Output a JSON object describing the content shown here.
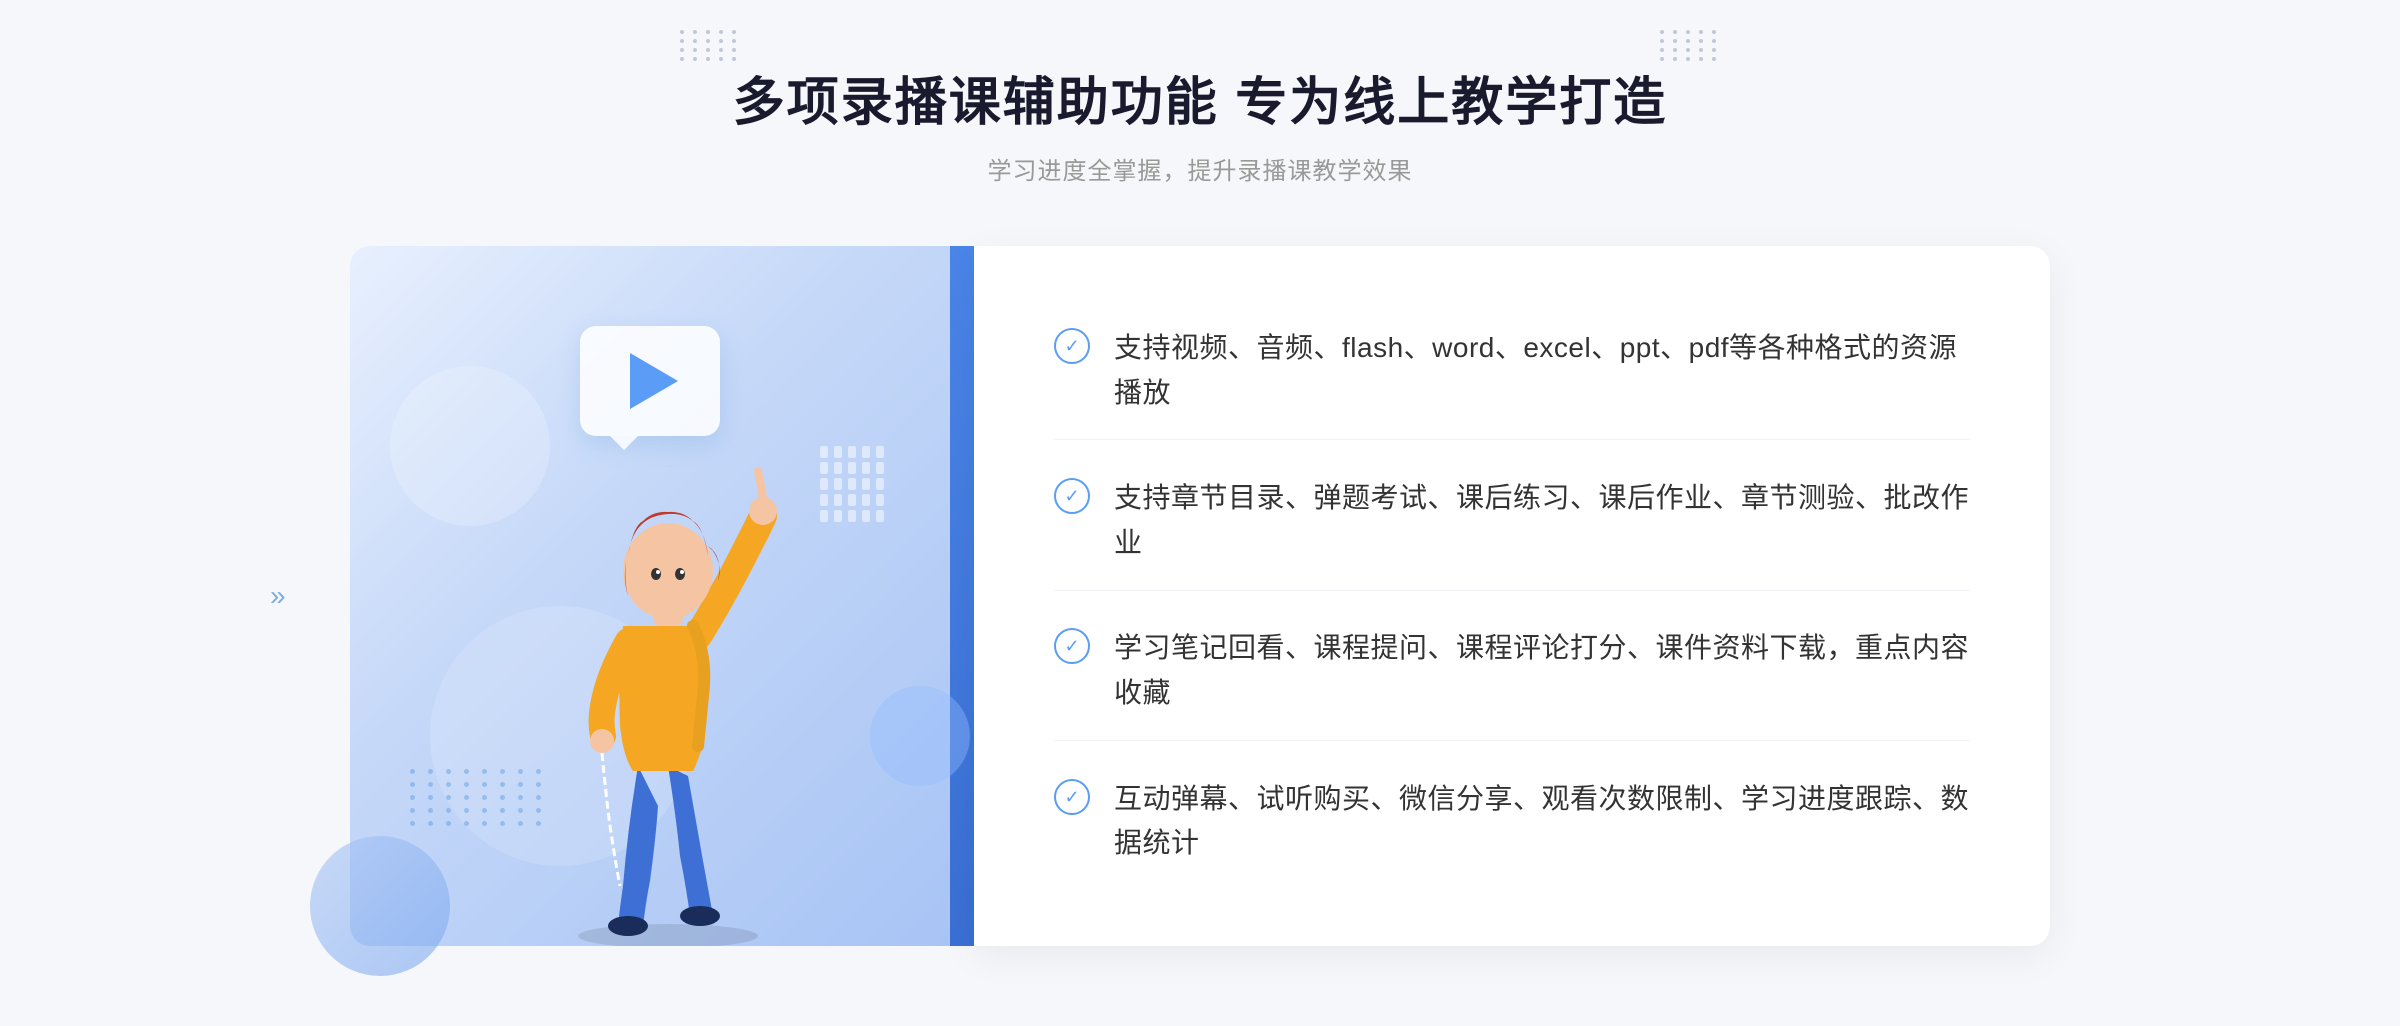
{
  "header": {
    "main_title": "多项录播课辅助功能 专为线上教学打造",
    "sub_title": "学习进度全掌握，提升录播课教学效果"
  },
  "features": [
    {
      "id": 1,
      "text": "支持视频、音频、flash、word、excel、ppt、pdf等各种格式的资源播放"
    },
    {
      "id": 2,
      "text": "支持章节目录、弹题考试、课后练习、课后作业、章节测验、批改作业"
    },
    {
      "id": 3,
      "text": "学习笔记回看、课程提问、课程评论打分、课件资料下载，重点内容收藏"
    },
    {
      "id": 4,
      "text": "互动弹幕、试听购买、微信分享、观看次数限制、学习进度跟踪、数据统计"
    }
  ],
  "icons": {
    "check": "✓",
    "play": "▶",
    "chevron_left": "«"
  },
  "colors": {
    "primary": "#5b9cf6",
    "light_blue": "#e8f0fe",
    "text_dark": "#1a1a2e",
    "text_light": "#999999",
    "text_feature": "#333333"
  }
}
